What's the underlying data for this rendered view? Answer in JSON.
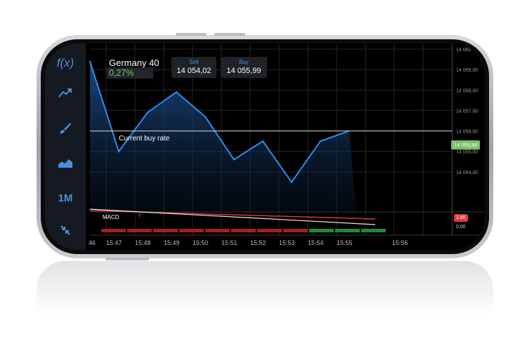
{
  "instrument": {
    "name": "Germany 40",
    "change": "0,27%"
  },
  "quotes": {
    "sell_label": "Sell",
    "sell_value": "14 054,02",
    "buy_label": "Buy",
    "buy_value": "14 055,99"
  },
  "toolbar": {
    "functions_label": "f(x)",
    "timeframe_label": "1M"
  },
  "chart": {
    "buy_rate_label": "Current buy rate",
    "current_price_tag": "14 055,99",
    "y_ticks": [
      "14 060",
      "14 059,00",
      "14 058,00",
      "14 057,00",
      "14 056,00",
      "14 055,00",
      "14 054,00"
    ],
    "x_ticks": [
      "46",
      "15:47",
      "15:48",
      "15:49",
      "15:50",
      "15:51",
      "15:52",
      "15:53",
      "15:54",
      "15:55",
      "15:56"
    ],
    "price_points": [
      {
        "t": "15:46",
        "v": 14059.4
      },
      {
        "t": "15:47",
        "v": 14055.0
      },
      {
        "t": "15:48",
        "v": 14056.9
      },
      {
        "t": "15:49",
        "v": 14057.9
      },
      {
        "t": "15:50",
        "v": 14056.7
      },
      {
        "t": "15:51",
        "v": 14054.6
      },
      {
        "t": "15:52",
        "v": 14055.5
      },
      {
        "t": "15:53",
        "v": 14053.5
      },
      {
        "t": "15:54",
        "v": 14055.5
      },
      {
        "t": "15:55",
        "v": 14056.0
      }
    ]
  },
  "macd": {
    "label": "MACD",
    "value_tag": "2,85",
    "zero_label": "0,00"
  },
  "colors": {
    "line": "#2d8cf0",
    "buy_tag": "#7bbf6a",
    "macd_tag": "#e0383e",
    "change_positive": "#7bbf6a"
  }
}
